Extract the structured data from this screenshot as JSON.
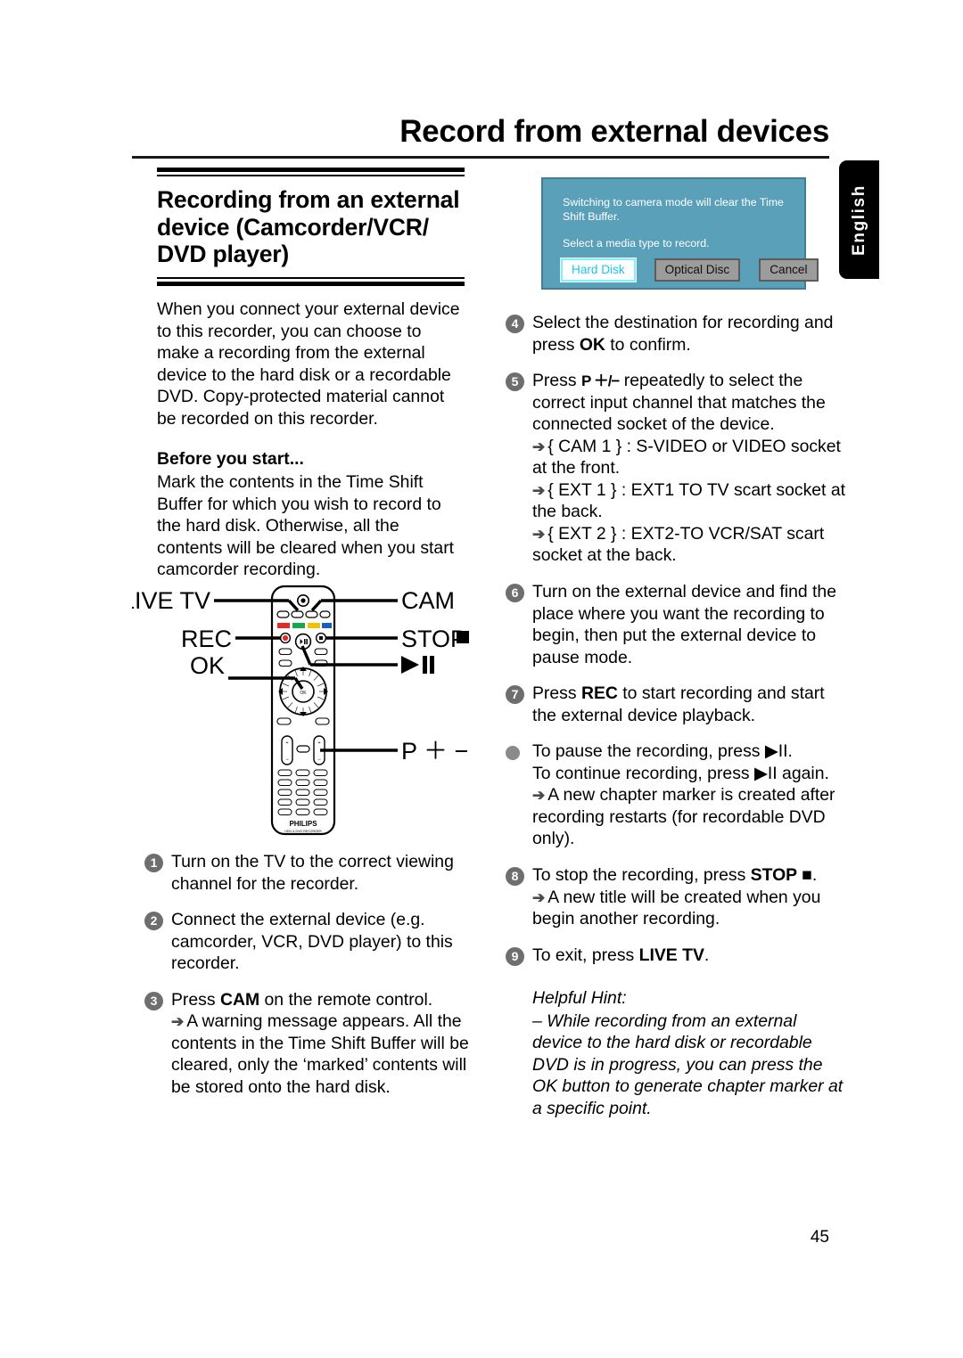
{
  "header": {
    "title": "Record from external devices",
    "language_tab": "English"
  },
  "section": {
    "heading": "Recording from an external device (Camcorder/VCR/ DVD player)"
  },
  "left_column": {
    "intro": "When you connect your external device to this recorder, you can choose to make a recording from the external device to the hard disk or a recordable DVD. Copy-protected material cannot be recorded on this recorder.",
    "subhead": "Before you start...",
    "before_start": "Mark the contents in the Time Shift Buffer for which you wish to record to the hard disk. Otherwise, all the contents will be cleared when you start camcorder recording.",
    "steps": [
      {
        "num": "1",
        "text": "Turn on the TV to the correct viewing channel for the recorder."
      },
      {
        "num": "2",
        "text": "Connect the external device (e.g. camcorder, VCR, DVD player) to this recorder."
      },
      {
        "num": "3",
        "lead": "Press ",
        "bold": "CAM",
        "tail": " on the remote control.",
        "sub": "A warning message appears. All the contents in the Time Shift Buffer will be cleared, only the ‘marked’ contents will be stored onto the hard disk."
      }
    ]
  },
  "tv_dialog": {
    "message_1": "Switching to camera mode will clear the Time Shift Buffer.",
    "message_2": "Select a media type to record.",
    "buttons": [
      {
        "label": "Hard Disk",
        "selected": true
      },
      {
        "label": "Optical Disc",
        "selected": false
      },
      {
        "label": "Cancel",
        "selected": false
      }
    ],
    "bg_color": "#5ba0b9",
    "selected_text_color": "#18c8e8"
  },
  "remote": {
    "brand": "PHILIPS",
    "model_text": "HDD & DVD RECORDER",
    "callouts": {
      "live_tv": "LIVE TV",
      "cam": "CAM",
      "rec": "REC",
      "stop": "STOP",
      "play_pause": "▶II",
      "ok": "OK",
      "p_plus_minus": "P ＋ −"
    }
  },
  "right_column": {
    "steps": [
      {
        "num": "4",
        "lead": "Select the destination for recording and press ",
        "bold": "OK",
        "tail": " to confirm."
      },
      {
        "num": "5",
        "lead": "Press ",
        "bold": "P ＋/−",
        "tail": " repeatedly to select the correct input channel that matches the connected socket of the device.",
        "subs": [
          "{ CAM 1 } : S-VIDEO or VIDEO socket at the front.",
          "{ EXT 1 } : EXT1 TO TV scart socket at the back.",
          "{ EXT 2 } : EXT2-TO VCR/SAT scart socket at the back."
        ]
      },
      {
        "num": "6",
        "text": "Turn on the external device and find the place where you want the recording to begin, then put the external device to pause mode."
      },
      {
        "num": "7",
        "lead": "Press ",
        "bold": "REC",
        "tail": " to start recording and start the external device playback."
      }
    ],
    "bullet": {
      "line_1": "To pause the recording, press ▶II.",
      "line_2": "To continue recording, press ▶II again.",
      "sub": "A new chapter marker is created after recording restarts (for recordable DVD only)."
    },
    "steps_tail": [
      {
        "num": "8",
        "lead": "To stop the recording, press ",
        "bold": "STOP ■",
        "tail": ".",
        "sub": "A new title will be created when you begin another recording."
      },
      {
        "num": "9",
        "lead": "To exit, press ",
        "bold": "LIVE TV",
        "tail": "."
      }
    ],
    "hint_title": "Helpful Hint:",
    "hint_body": "– While recording from an external device to the hard disk or recordable DVD is in progress, you can press the OK button to generate chapter marker at a specific point."
  },
  "footer": {
    "page_number": "45"
  }
}
